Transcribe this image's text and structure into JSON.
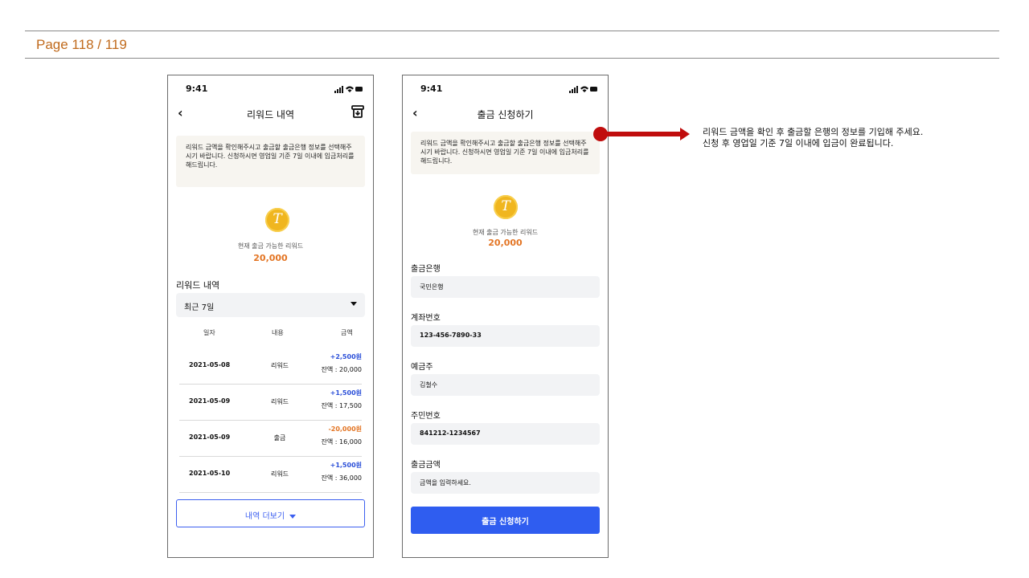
{
  "page": {
    "label": "Page 118 / 119"
  },
  "status_bar": {
    "time": "9:41"
  },
  "screen_reward": {
    "title": "리워드 내역",
    "notice": "리워드 금액을 확인해주시고 출금할 출금은행 정보를 선택해주시기 바랍니다. 신청하시면 영업일 기준 7일 이내에 입금처리를 해드립니다.",
    "available_label": "현재 출금 가능한 리워드",
    "available_amount": "20,000",
    "section_title": "리워드 내역",
    "period_select": "최근 7일",
    "columns": [
      "일자",
      "내용",
      "금액"
    ],
    "rows": [
      {
        "date": "2021-05-08",
        "type": "리워드",
        "delta": "+2,500원",
        "balance": "잔액 : 20,000",
        "sign": "plus"
      },
      {
        "date": "2021-05-09",
        "type": "리워드",
        "delta": "+1,500원",
        "balance": "잔액 : 17,500",
        "sign": "plus"
      },
      {
        "date": "2021-05-09",
        "type": "출금",
        "delta": "-20,000원",
        "balance": "잔액 : 16,000",
        "sign": "minus"
      },
      {
        "date": "2021-05-10",
        "type": "리워드",
        "delta": "+1,500원",
        "balance": "잔액 : 36,000",
        "sign": "plus"
      }
    ],
    "more_button": "내역 더보기"
  },
  "screen_withdraw": {
    "title": "출금 신청하기",
    "notice": "리워드 금액을 확인해주시고 출금할 출금은행 정보를 선택해주시기 바랍니다. 신청하시면 영업일 기준 7일 이내에 입금처리를 해드립니다.",
    "available_label": "현재 출금 가능한 리워드",
    "available_amount": "20,000",
    "fields": [
      {
        "label": "출금은행",
        "value": "국민은행"
      },
      {
        "label": "계좌번호",
        "value": "123-456-7890-33"
      },
      {
        "label": "예금주",
        "value": "김철수"
      },
      {
        "label": "주민번호",
        "value": "841212-1234567"
      },
      {
        "label": "출금금액",
        "value": "금액을 입력하세요."
      }
    ],
    "submit_button": "출금 신청하기"
  },
  "annotation": {
    "line1": "리워드 금액을 확인 후 출금할 은행의 정보를 기입해 주세요.",
    "line2": "신청 후 영업일 기준 7일 이내에 입금이 완료됩니다."
  },
  "colors": {
    "accent_blue": "#2f5df0",
    "amount_orange": "#e37524",
    "annotation_red": "#c00d0d",
    "coin_gold": "#f0b61f"
  }
}
